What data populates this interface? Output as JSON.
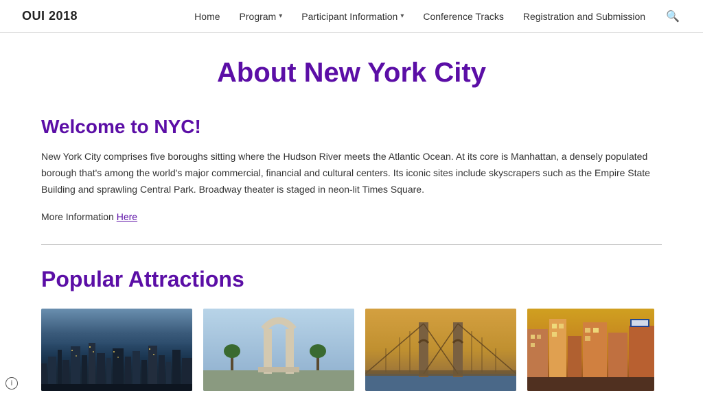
{
  "site": {
    "title": "OUI 2018"
  },
  "nav": {
    "items": [
      {
        "label": "Home",
        "has_dropdown": false
      },
      {
        "label": "Program",
        "has_dropdown": true
      },
      {
        "label": "Participant Information",
        "has_dropdown": true
      },
      {
        "label": "Conference Tracks",
        "has_dropdown": false
      },
      {
        "label": "Registration and Submission",
        "has_dropdown": false
      }
    ]
  },
  "page": {
    "title": "About New York City"
  },
  "welcome": {
    "heading": "Welcome to NYC!",
    "body": "New York City comprises five boroughs sitting where the Hudson River meets the Atlantic Ocean. At its core is Manhattan, a densely populated borough that's among the world's major commercial, financial and cultural centers. Its iconic sites include skyscrapers such as the Empire State Building and sprawling Central Park. Broadway theater is staged in neon-lit Times Square.",
    "more_info_label": "More Information",
    "more_info_link_label": "Here"
  },
  "attractions": {
    "heading": "Popular Attractions",
    "cards": [
      {
        "label": "NYC Skyline"
      },
      {
        "label": "Washington Square Arch"
      },
      {
        "label": "Brooklyn Bridge"
      },
      {
        "label": "NYC Street"
      }
    ]
  },
  "colors": {
    "accent": "#5b0ea6",
    "link": "#5b0ea6"
  }
}
